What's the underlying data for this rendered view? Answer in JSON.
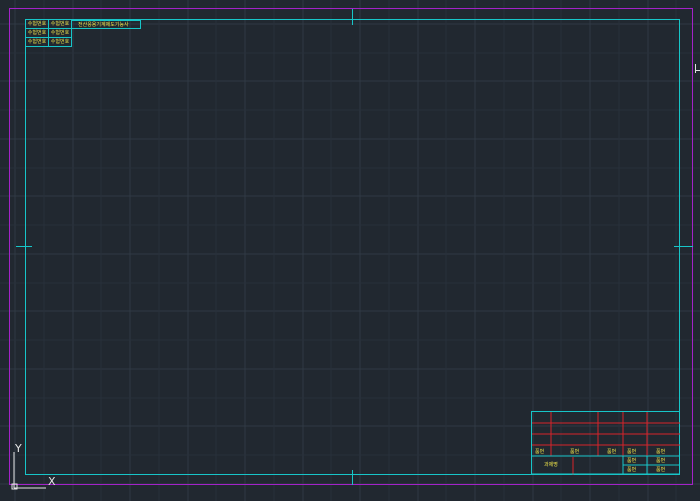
{
  "drawing": {
    "ucs_x_label": "X",
    "ucs_y_label": "Y"
  },
  "top_left_table": {
    "cells": [
      "수험번호",
      "수험번호",
      "수험번호",
      "수험번호",
      "수험번호",
      "수험번호"
    ],
    "title": "전산응용기계제도기능사"
  },
  "title_block": {
    "labels": [
      "품번",
      "품번",
      "품번",
      "품번",
      "품번",
      "품번",
      "품번",
      "품번",
      "품번",
      "과제명"
    ]
  },
  "colors": {
    "background": "#212830",
    "outer_border": "#a322c8",
    "inner_border": "#17c5c8",
    "red_lines": "#d8232a",
    "text": "#f0e54a"
  }
}
